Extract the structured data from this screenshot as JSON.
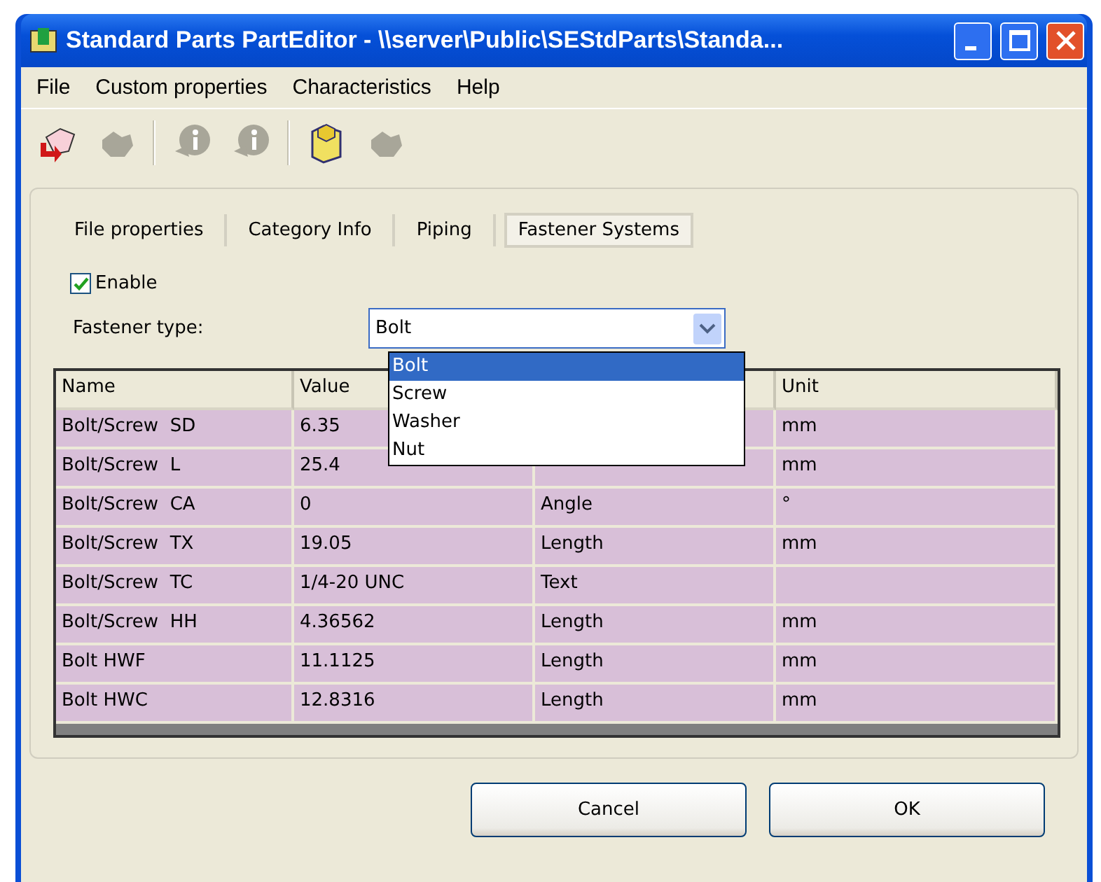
{
  "window": {
    "title": "Standard Parts PartEditor - \\\\server\\Public\\SEStdParts\\Standa..."
  },
  "menu": [
    "File",
    "Custom properties",
    "Characteristics",
    "Help"
  ],
  "toolbar": [
    {
      "kind": "hand",
      "disabled": false
    },
    {
      "kind": "blob",
      "disabled": true
    },
    {
      "kind": "sep"
    },
    {
      "kind": "info",
      "disabled": true
    },
    {
      "kind": "info",
      "disabled": true
    },
    {
      "kind": "sep"
    },
    {
      "kind": "folder",
      "disabled": false
    },
    {
      "kind": "blob",
      "disabled": true
    }
  ],
  "tabs": [
    {
      "label": "File properties",
      "selected": false
    },
    {
      "label": "Category Info",
      "selected": false
    },
    {
      "label": "Piping",
      "selected": false
    },
    {
      "label": "Fastener Systems",
      "selected": true
    }
  ],
  "enable": {
    "label": "Enable",
    "checked": true
  },
  "fastener_type": {
    "label": "Fastener type:",
    "value": "Bolt",
    "expanded": true,
    "options": [
      {
        "label": "Bolt",
        "selected": true
      },
      {
        "label": "Screw",
        "selected": false
      },
      {
        "label": "Washer",
        "selected": false
      },
      {
        "label": "Nut",
        "selected": false
      }
    ]
  },
  "table": {
    "columns": [
      {
        "label": "Name"
      },
      {
        "label": "Value"
      },
      {},
      {
        "label": "Unit"
      }
    ],
    "rows": [
      [
        "Bolt/Screw  SD",
        "6.35",
        null,
        "mm"
      ],
      [
        "Bolt/Screw  L",
        "25.4",
        null,
        "mm"
      ],
      [
        "Bolt/Screw  CA",
        "0",
        "Angle",
        "°"
      ],
      [
        "Bolt/Screw  TX",
        "19.05",
        "Length",
        "mm"
      ],
      [
        "Bolt/Screw  TC",
        "1/4-20 UNC",
        "Text",
        null
      ],
      [
        "Bolt/Screw  HH",
        "4.36562",
        "Length",
        "mm"
      ],
      [
        "Bolt HWF",
        "11.1125",
        "Length",
        "mm"
      ],
      [
        "Bolt HWC",
        "12.8316",
        "Length",
        "mm"
      ]
    ]
  },
  "buttons": [
    "Cancel",
    "OK"
  ]
}
